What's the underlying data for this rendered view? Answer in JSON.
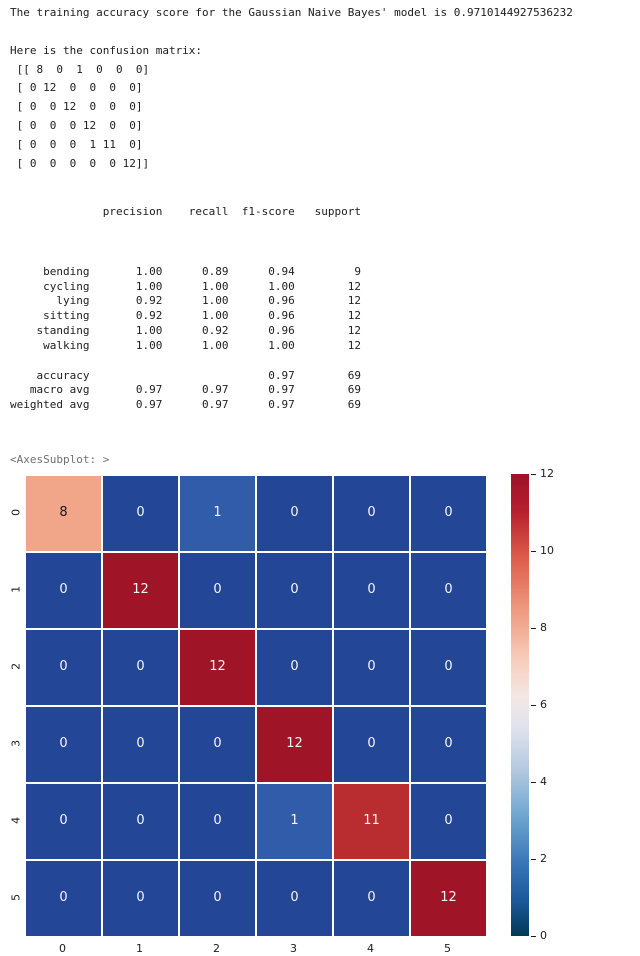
{
  "text": {
    "accuracy_line": "The training accuracy score for the Gaussian Naive Bayes' model is 0.9710144927536232",
    "matrix_intro": "Here is the confusion matrix:",
    "axes_repr": "<AxesSubplot: >"
  },
  "confusion_matrix_print": [
    " [[ 8  0  1  0  0  0]",
    " [ 0 12  0  0  0  0]",
    " [ 0  0 12  0  0  0]",
    " [ 0  0  0 12  0  0]",
    " [ 0  0  0  1 11  0]",
    " [ 0  0  0  0  0 12]]"
  ],
  "report": {
    "headers": "              precision    recall  f1-score   support",
    "rows": [
      "",
      "     bending       1.00      0.89      0.94         9",
      "     cycling       1.00      1.00      1.00        12",
      "       lying       0.92      1.00      0.96        12",
      "     sitting       0.92      1.00      0.96        12",
      "    standing       1.00      0.92      0.96        12",
      "     walking       1.00      1.00      1.00        12",
      "",
      "    accuracy                           0.97        69",
      "   macro avg       0.97      0.97      0.97        69",
      "weighted avg       0.97      0.97      0.97        69"
    ]
  },
  "chart_data": {
    "type": "heatmap",
    "title": "",
    "xlabel": "",
    "ylabel": "",
    "x_categories": [
      "0",
      "1",
      "2",
      "3",
      "4",
      "5"
    ],
    "y_categories": [
      "0",
      "1",
      "2",
      "3",
      "4",
      "5"
    ],
    "class_labels": [
      "bending",
      "cycling",
      "lying",
      "sitting",
      "standing",
      "walking"
    ],
    "values": [
      [
        8,
        0,
        1,
        0,
        0,
        0
      ],
      [
        0,
        12,
        0,
        0,
        0,
        0
      ],
      [
        0,
        0,
        12,
        0,
        0,
        0
      ],
      [
        0,
        0,
        0,
        12,
        0,
        0
      ],
      [
        0,
        0,
        0,
        1,
        11,
        0
      ],
      [
        0,
        0,
        0,
        0,
        0,
        12
      ]
    ],
    "vmin": 0,
    "vmax": 12,
    "colorbar_ticks": [
      0,
      2,
      4,
      6,
      8,
      10,
      12
    ],
    "colormap": "coolwarm",
    "annot": true
  }
}
